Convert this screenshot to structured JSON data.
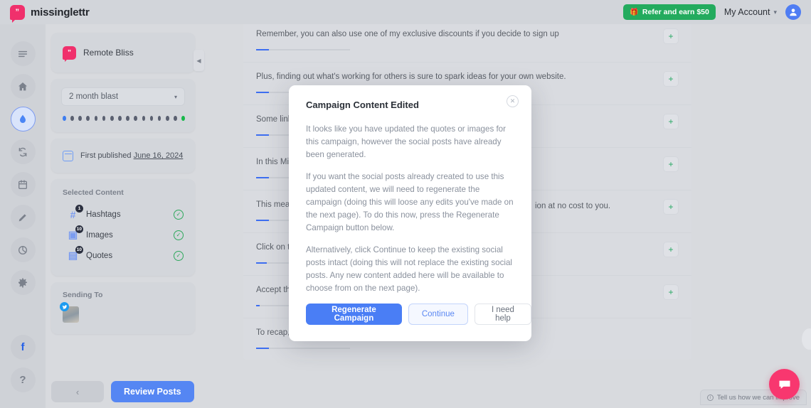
{
  "header": {
    "brand_name": "missinglettr",
    "brand_mark_glyph": "”",
    "refer_label": "Refer and earn $50",
    "refer_icon": "gift-icon",
    "refer_color": "#23ab5e",
    "account_label": "My Account",
    "caret_glyph": "▾",
    "avatar_glyph": "●"
  },
  "rail": {
    "items": [
      {
        "name": "menu-icon",
        "active": false
      },
      {
        "name": "home-icon",
        "active": false
      },
      {
        "name": "drip-icon",
        "active": true
      },
      {
        "name": "curate-icon",
        "active": false
      },
      {
        "name": "calendar-icon",
        "active": false
      },
      {
        "name": "compose-icon",
        "active": false
      },
      {
        "name": "analytics-icon",
        "active": false
      },
      {
        "name": "settings-icon",
        "active": false
      }
    ],
    "facebook_label": "f",
    "help_label": "?"
  },
  "sidebar": {
    "campaign_title": "Remote Bliss",
    "blast_select_value": "2 month blast",
    "caret_glyph": "▾",
    "dots_total": 16,
    "published_prefix": "First published ",
    "published_date": "June 16, 2024",
    "selected_content_label": "Selected Content",
    "content_items": [
      {
        "icon": "hashtag-icon",
        "glyph": "#",
        "badge": "1",
        "label": "Hashtags",
        "checked": true
      },
      {
        "icon": "image-icon",
        "glyph": "▣",
        "badge": "10",
        "label": "Images",
        "checked": true
      },
      {
        "icon": "quote-icon",
        "glyph": "▤",
        "badge": "10",
        "label": "Quotes",
        "checked": true
      }
    ],
    "check_glyph": "✓",
    "sending_to_label": "Sending To",
    "sending_accounts": [
      {
        "network": "twitter-icon",
        "glyph": "✦"
      }
    ],
    "collapse_glyph": "◀"
  },
  "bottom_bar": {
    "prev_glyph": "‹",
    "review_label": "Review Posts"
  },
  "main": {
    "rows": [
      {
        "text": "Remember, you can also use one of my exclusive discounts if you decide to sign up",
        "progress": 14,
        "plus": "+"
      },
      {
        "text": "Plus, finding out what's working for others is sure to spark ideas for your own website.",
        "progress": 14,
        "plus": "+"
      },
      {
        "text": "Some links",
        "progress": 14,
        "plus": "+"
      },
      {
        "text": "In this Miss",
        "progress": 14,
        "plus": "+"
      },
      {
        "text": "This means",
        "progress": 14,
        "plus": "+"
      },
      {
        "text": "Click on the",
        "progress": 12,
        "plus": "+"
      },
      {
        "text": "Accept the",
        "progress": 4,
        "plus": "+"
      },
      {
        "text": "To recap, h",
        "progress": 14,
        "plus": "+"
      }
    ],
    "partial_text_right": "ion at no cost to you."
  },
  "modal": {
    "title": "Campaign Content Edited",
    "close_glyph": "✕",
    "paragraphs": [
      "It looks like you have updated the quotes or images for this campaign, however the social posts have already been generated.",
      "If you want the social posts already created to use this updated content, we will need to regenerate the campaign (doing this will loose any edits you've made on the next page). To do this now, press the Regenerate Campaign button below.",
      "Alternatively, click Continue to keep the existing social posts intact (doing this will not replace the existing social posts. Any new content added here will be available to choose from on the next page)."
    ],
    "primary_label": "Regenerate Campaign",
    "secondary_label": "Continue",
    "tertiary_label": "I need help",
    "primary_color": "#4a7ef5"
  },
  "footer": {
    "feedback_label": "Tell us how we can improve",
    "info_glyph": "i",
    "chat_icon": "chat-bubble-icon"
  }
}
